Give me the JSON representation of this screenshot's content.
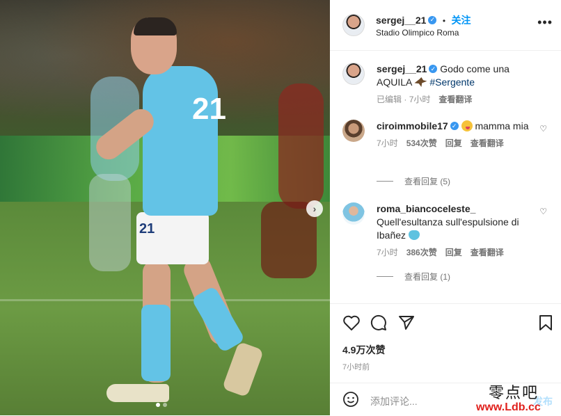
{
  "post": {
    "username": "sergej__21",
    "follow_label": "关注",
    "separator": "•",
    "location": "Stadio Olimpico Roma",
    "more_label": "•••",
    "player_number": "21",
    "caption": {
      "text_before": "Godo come una AQUILA",
      "hashtag": "#Sergente",
      "edited": "已编辑",
      "age": "7小时",
      "translate": "查看翻译"
    }
  },
  "comments": [
    {
      "username": "ciroimmobile17",
      "text": "mamma mia",
      "age": "7小时",
      "likes": "534次赞",
      "reply": "回复",
      "translate": "查看翻译",
      "view_replies": "查看回复 (5)"
    },
    {
      "username": "roma_biancoceleste_",
      "text": "Quell'esultanza sull'espulsione di Ibañez",
      "age": "7小时",
      "likes": "386次赞",
      "reply": "回复",
      "translate": "查看翻译",
      "view_replies": "查看回复 (1)"
    }
  ],
  "engagement": {
    "likes": "4.9万次赞",
    "time_ago": "7小时前"
  },
  "composer": {
    "placeholder": "添加评论...",
    "post_label": "发布"
  },
  "watermark": {
    "cn": "零点吧",
    "url": "www.Ldb.cc"
  },
  "icons": [
    "more-icon",
    "verified-badge-icon",
    "heart-icon",
    "comment-icon",
    "share-icon",
    "bookmark-icon",
    "emoji-icon",
    "next-arrow-icon"
  ],
  "colors": {
    "accent": "#0095f6",
    "verified": "#3897f0",
    "hashtag": "#00376b",
    "muted": "#8e8e8e",
    "watermark_red": "#e0201c"
  },
  "carousel": {
    "total": 2,
    "active": 1
  }
}
